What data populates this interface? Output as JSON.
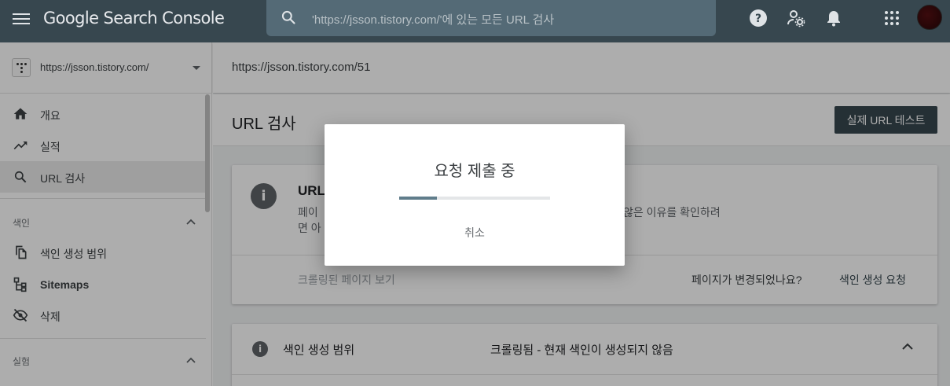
{
  "header": {
    "brand": "Google Search Console",
    "search_placeholder": "'https://jsson.tistory.com/'에 있는 모든 URL 검사"
  },
  "sidebar": {
    "property_url": "https://jsson.tistory.com/",
    "items": [
      {
        "label": "개요",
        "icon": "home-icon"
      },
      {
        "label": "실적",
        "icon": "trending-up-icon"
      },
      {
        "label": "URL 검사",
        "icon": "search-icon",
        "active": true
      }
    ],
    "index_section": {
      "label": "색인",
      "items": [
        {
          "label": "색인 생성 범위",
          "icon": "pages-icon"
        },
        {
          "label": "Sitemaps",
          "icon": "sitemap-icon"
        },
        {
          "label": "삭제",
          "icon": "visibility-off-icon"
        }
      ]
    },
    "experiment_section": {
      "label": "실험"
    }
  },
  "main": {
    "inspected_url": "https://jsson.tistory.com/51",
    "page_title": "URL 검사",
    "test_button": "실제 URL 테스트",
    "card": {
      "title": "URL",
      "desc_line1_left": "페이",
      "desc_line1_right": "않은 이유를 확인하려",
      "desc_line2": "면 아",
      "crawled_link": "크롤링된 페이지 보기",
      "changed_question": "페이지가 변경되었나요?",
      "request_indexing": "색인 생성 요청"
    },
    "coverage": {
      "label": "색인 생성 범위",
      "status": "크롤링됨 - 현재 색인이 생성되지 않음"
    }
  },
  "dialog": {
    "title": "요청 제출 중",
    "progress": 0.25,
    "cancel": "취소"
  },
  "colors": {
    "header_bg": "#37474f",
    "accent": "#607d8b"
  }
}
